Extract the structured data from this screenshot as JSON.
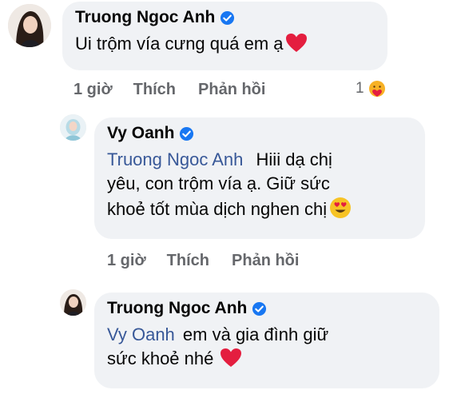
{
  "comments": [
    {
      "author": "Truong Ngoc Anh",
      "verified": true,
      "text": "Ui trộm vía cưng quá em ạ",
      "trailing_icon": "red-heart-icon",
      "time": "1 giờ",
      "like_label": "Thích",
      "reply_label": "Phản hồi",
      "reaction_count": "1",
      "reaction_icon": "care-reaction-icon"
    },
    {
      "author": "Vy Oanh",
      "verified": true,
      "mention": "Truong Ngoc Anh",
      "text_line1": "Hiii dạ chị",
      "text_line2": "yêu, con trộm vía ạ. Giữ sức",
      "text_line3": "khoẻ tốt mùa dịch nghen chị",
      "trailing_icon": "heart-eyes-emoji-icon",
      "time": "1 giờ",
      "like_label": "Thích",
      "reply_label": "Phản hồi"
    },
    {
      "author": "Truong Ngoc Anh",
      "verified": true,
      "mention": "Vy Oanh",
      "text_line1": "em và gia đình giữ",
      "text_line2": "sức khoẻ nhé",
      "trailing_icon": "red-heart-icon"
    }
  ],
  "colors": {
    "bubble_bg": "#f0f2f5",
    "mention": "#385898",
    "meta": "#65676b",
    "verified": "#1877f2",
    "heart": "#e41e3f"
  }
}
